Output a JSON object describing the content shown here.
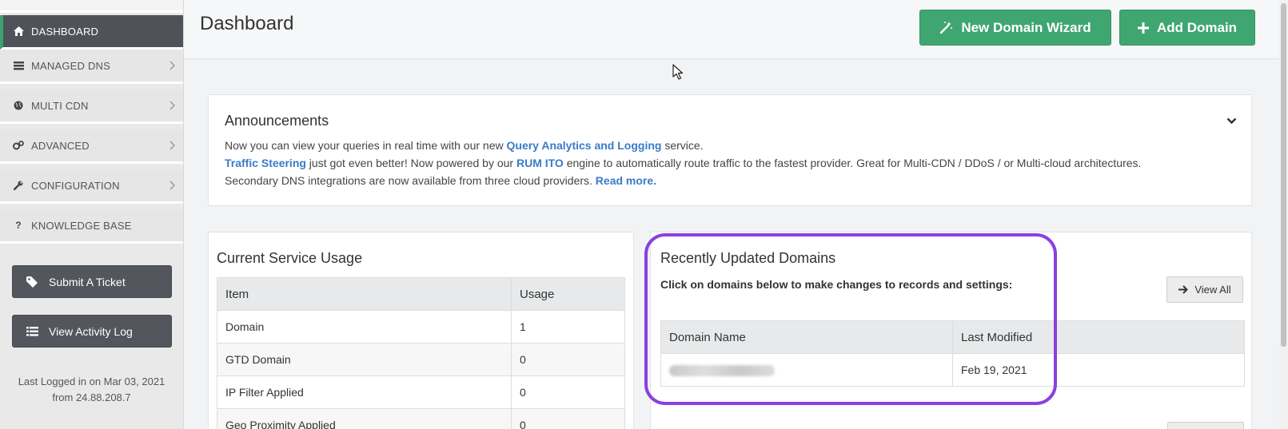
{
  "sidebar": {
    "items": [
      {
        "label": "DASHBOARD",
        "icon": "home-icon",
        "active": true
      },
      {
        "label": "MANAGED DNS",
        "icon": "list-icon"
      },
      {
        "label": "MULTI CDN",
        "icon": "globe-icon"
      },
      {
        "label": "ADVANCED",
        "icon": "gears-icon"
      },
      {
        "label": "CONFIGURATION",
        "icon": "wrench-icon"
      },
      {
        "label": "KNOWLEDGE BASE",
        "icon": "question-icon"
      }
    ],
    "submit_ticket_label": "Submit A Ticket",
    "activity_log_label": "View Activity Log",
    "last_login_line1": "Last Logged in on Mar 03, 2021",
    "last_login_line2": "from 24.88.208.7"
  },
  "header": {
    "title": "Dashboard",
    "wizard_label": "New Domain Wizard",
    "add_domain_label": "Add Domain"
  },
  "announcements": {
    "title": "Announcements",
    "line1_pre": "Now you can view your queries in real time with our new ",
    "line1_link": "Query Analytics and Logging",
    "line1_post": " service.",
    "line2_link1": "Traffic Steering",
    "line2_mid": " just got even better! Now powered by our ",
    "line2_link2": "RUM ITO",
    "line2_post": " engine to automatically route traffic to the fastest provider. Great for Multi-CDN / DDoS / or Multi-cloud architectures.",
    "line3_pre": "Secondary DNS integrations are now available from three cloud providers. ",
    "line3_link": "Read more."
  },
  "usage": {
    "title": "Current Service Usage",
    "columns": [
      "Item",
      "Usage"
    ],
    "rows": [
      [
        "Domain",
        "1"
      ],
      [
        "GTD Domain",
        "0"
      ],
      [
        "IP Filter Applied",
        "0"
      ],
      [
        "Geo Proximity Applied",
        "0"
      ]
    ]
  },
  "recent": {
    "title": "Recently Updated Domains",
    "subtitle": "Click on domains below to make changes to records and settings:",
    "view_all_label": "View All",
    "columns": [
      "Domain Name",
      "Last Modified"
    ],
    "rows": [
      {
        "last_modified": "Feb 19, 2021"
      }
    ]
  },
  "colors": {
    "accent_green": "#3fa672",
    "sidebar_active": "#4f5259",
    "link_blue": "#3a7bc8",
    "highlight_purple": "#8b3fe0"
  }
}
